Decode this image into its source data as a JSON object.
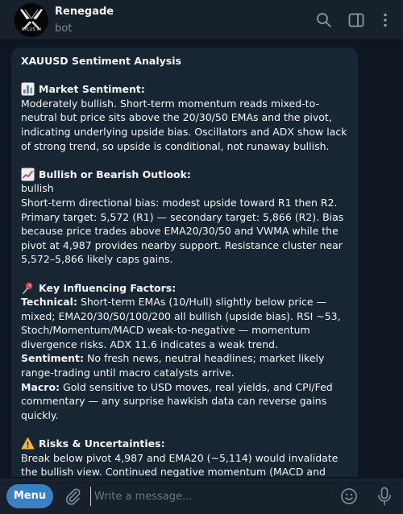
{
  "header": {
    "title": "Renegade",
    "status": "bot",
    "avatar_text": "XPLUS AI"
  },
  "message": {
    "title": "XAUUSD Sentiment Analysis",
    "sections": {
      "sentiment": {
        "icon": "bar-chart-emoji",
        "heading": "Market Sentiment:",
        "text": "Moderately bullish. Short-term momentum reads mixed-to-neutral but price sits above the 20/30/50 EMAs and the pivot, indicating underlying upside bias. Oscillators and ADX show lack of strong trend, so upside is conditional, not runaway bullish."
      },
      "outlook": {
        "icon": "chart-increasing-emoji",
        "heading": "Bullish or Bearish Outlook:",
        "verdict": "bullish",
        "text": "Short-term directional bias: modest upside toward R1 then R2. Primary target: 5,572 (R1) — secondary target: 5,866 (R2). Bias because price trades above EMA20/30/50 and VWMA while the pivot at 4,987 provides nearby support. Resistance cluster near 5,572–5,866 likely caps gains."
      },
      "factors": {
        "icon": "pushpin-emoji",
        "heading": "Key Influencing Factors:",
        "technical_label": "Technical:",
        "technical_text": " Short-term EMAs (10/Hull) slightly below price — mixed; EMA20/30/50/100/200 all bullish (upside bias). RSI ~53, Stoch/Momentum/MACD weak-to-negative — momentum divergence risks. ADX 11.6 indicates a weak trend.",
        "sentiment_label": "Sentiment:",
        "sentiment_text": " No fresh news, neutral headlines; market likely range-trading until macro catalysts arrive.",
        "macro_label": "Macro:",
        "macro_text": " Gold sensitive to USD moves, real yields, and CPI/Fed commentary — any surprise hawkish data can reverse gains quickly."
      },
      "risks": {
        "icon": "warning-emoji",
        "heading": "Risks & Uncertainties:",
        "text": "Break below pivot 4,987 and EMA20 (~5,114) would invalidate the bullish view. Continued negative momentum (MACD and"
      }
    }
  },
  "composer": {
    "menu_label": "Menu",
    "placeholder": "Write a message..."
  },
  "colors": {
    "background": "#0e1621",
    "topbar": "#17212b",
    "bubble": "#182533",
    "accent": "#3a80c5",
    "muted": "#7d8b99"
  }
}
